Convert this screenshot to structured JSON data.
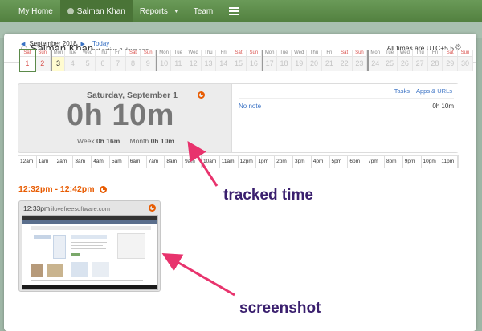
{
  "nav": {
    "my_home": "My Home",
    "user": "Salman Khan",
    "reports": "Reports",
    "team": "Team"
  },
  "header": {
    "name": "Salman Khan",
    "last_active": "last active 2 days ago",
    "timezone": "All times are UTC+5.5"
  },
  "month": {
    "label": "September 2018",
    "today": "Today"
  },
  "calendar": [
    {
      "d": "Sat",
      "n": "1"
    },
    {
      "d": "Sun",
      "n": "2"
    },
    {
      "d": "Mon",
      "n": "3"
    },
    {
      "d": "Tue",
      "n": "4"
    },
    {
      "d": "Wed",
      "n": "5"
    },
    {
      "d": "Thu",
      "n": "6"
    },
    {
      "d": "Fri",
      "n": "7"
    },
    {
      "d": "Sat",
      "n": "8"
    },
    {
      "d": "Sun",
      "n": "9"
    },
    {
      "d": "Mon",
      "n": "10"
    },
    {
      "d": "Tue",
      "n": "11"
    },
    {
      "d": "Wed",
      "n": "12"
    },
    {
      "d": "Thu",
      "n": "13"
    },
    {
      "d": "Fri",
      "n": "14"
    },
    {
      "d": "Sat",
      "n": "15"
    },
    {
      "d": "Sun",
      "n": "16"
    },
    {
      "d": "Mon",
      "n": "17"
    },
    {
      "d": "Tue",
      "n": "18"
    },
    {
      "d": "Wed",
      "n": "19"
    },
    {
      "d": "Thu",
      "n": "20"
    },
    {
      "d": "Fri",
      "n": "21"
    },
    {
      "d": "Sat",
      "n": "22"
    },
    {
      "d": "Sun",
      "n": "23"
    },
    {
      "d": "Mon",
      "n": "24"
    },
    {
      "d": "Tue",
      "n": "25"
    },
    {
      "d": "Wed",
      "n": "26"
    },
    {
      "d": "Thu",
      "n": "27"
    },
    {
      "d": "Fri",
      "n": "28"
    },
    {
      "d": "Sat",
      "n": "29"
    },
    {
      "d": "Sun",
      "n": "30"
    }
  ],
  "summary": {
    "date": "Saturday, September 1",
    "total": "0h 10m",
    "week_label": "Week",
    "week_value": "0h 16m",
    "month_label": "Month",
    "month_value": "0h 10m",
    "tab_tasks": "Tasks",
    "tab_apps": "Apps & URLs",
    "note": "No note",
    "note_time": "0h 10m"
  },
  "timeline": [
    "12am",
    "1am",
    "2am",
    "3am",
    "4am",
    "5am",
    "6am",
    "7am",
    "8am",
    "9am",
    "10am",
    "11am",
    "12pm",
    "1pm",
    "2pm",
    "3pm",
    "4pm",
    "5pm",
    "6pm",
    "7pm",
    "8pm",
    "9pm",
    "10pm",
    "11pm"
  ],
  "range": "12:32pm - 12:42pm",
  "screenshot": {
    "time": "12:33pm",
    "site": "ilovefreesoftware.com"
  },
  "annotations": {
    "tracked": "tracked time",
    "screenshot": "screenshot",
    "color": "#e8336d"
  }
}
